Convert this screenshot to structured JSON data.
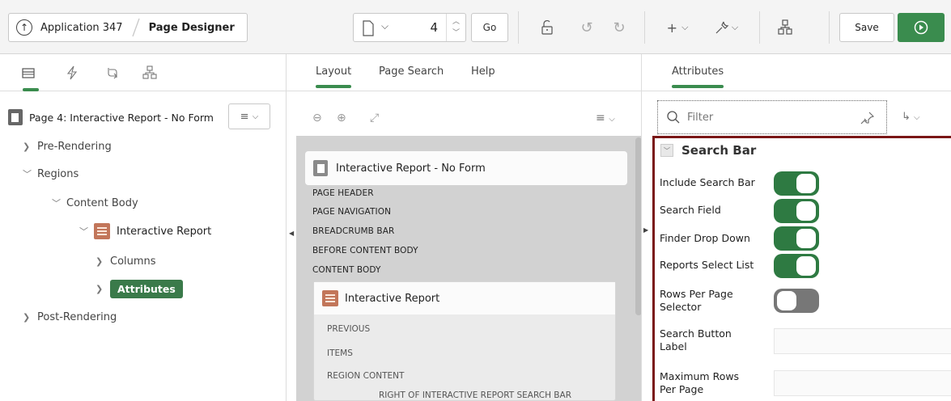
{
  "toolbar": {
    "app_name": "Application 347",
    "page_designer": "Page Designer",
    "page_number": "4",
    "go_label": "Go",
    "save_label": "Save",
    "add_caret": "+",
    "colors": {
      "run": "#3a8c4e"
    }
  },
  "left": {
    "page_title": "Page 4: Interactive Report - No Form",
    "tree": {
      "pre_rendering": "Pre-Rendering",
      "regions": "Regions",
      "content_body": "Content Body",
      "interactive_report": "Interactive Report",
      "columns": "Columns",
      "attributes": "Attributes",
      "post_rendering": "Post-Rendering"
    }
  },
  "center": {
    "tabs": {
      "layout": "Layout",
      "page_search": "Page Search",
      "help": "Help"
    },
    "region_noform": "Interactive Report - No Form",
    "positions": {
      "page_header": "PAGE HEADER",
      "page_navigation": "PAGE NAVIGATION",
      "breadcrumb_bar": "BREADCRUMB BAR",
      "before_content_body": "BEFORE CONTENT BODY",
      "content_body": "CONTENT BODY"
    },
    "ir_card": {
      "title": "Interactive Report",
      "previous": "PREVIOUS",
      "items": "ITEMS",
      "region_content": "REGION CONTENT",
      "right_of_search": "RIGHT OF INTERACTIVE REPORT SEARCH BAR"
    }
  },
  "right": {
    "tab": "Attributes",
    "filter_placeholder": "Filter",
    "section": "Search Bar",
    "props": {
      "include_search_bar": {
        "label": "Include Search Bar",
        "on": true
      },
      "search_field": {
        "label": "Search Field",
        "on": true
      },
      "finder_drop_down": {
        "label": "Finder Drop Down",
        "on": true
      },
      "reports_select_list": {
        "label": "Reports Select List",
        "on": true
      },
      "rows_per_page_selector": {
        "label": "Rows Per Page Selector",
        "on": false
      },
      "search_button_label": {
        "label": "Search Button Label",
        "value": ""
      },
      "maximum_rows_per_page": {
        "label": "Maximum Rows Per Page",
        "value": ""
      }
    }
  }
}
